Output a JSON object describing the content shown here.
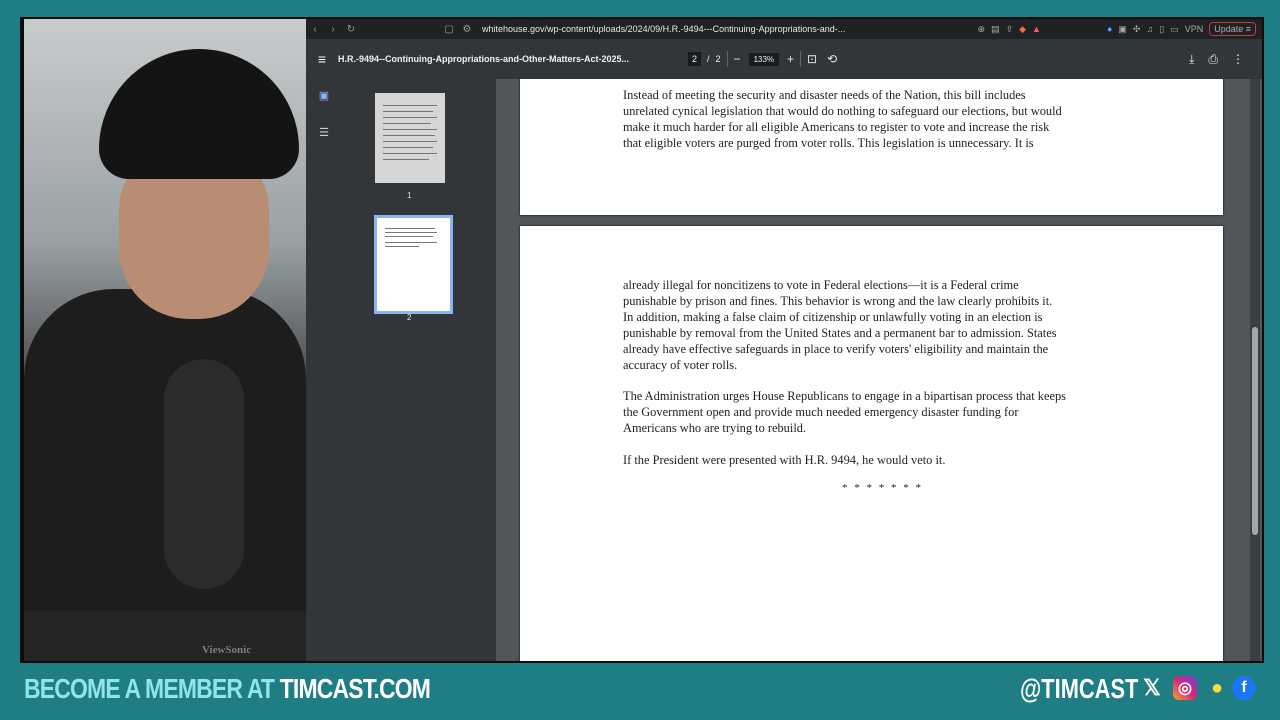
{
  "browser": {
    "url": "whitehouse.gov/wp-content/uploads/2024/09/H.R.-9494---Continuing-Appropriations-and-...",
    "vpn_label": "VPN",
    "update_label": "Update",
    "badge_count": "1"
  },
  "pdf": {
    "title": "H.R.-9494--Continuing-Appropriations-and-Other-Matters-Act-2025...",
    "current_page": "2",
    "page_sep": "/",
    "total_pages": "2",
    "zoom": "133%",
    "thumbnails": [
      {
        "label": "1"
      },
      {
        "label": "2"
      }
    ],
    "page1_text": "Instead of meeting the security and disaster needs of the Nation, this bill includes\nunrelated cynical legislation that would do nothing to safeguard our elections, but would\nmake it much harder for all eligible Americans to register to vote and increase the risk\nthat eligible voters are purged from voter rolls.  This legislation is unnecessary.  It is",
    "page2_para1": "already illegal for noncitizens to vote in Federal elections—it is a Federal crime\npunishable by prison and fines.  This behavior is wrong and the law clearly prohibits it.\nIn addition, making a false claim of citizenship or unlawfully voting in an election is\npunishable by removal from the United States and a permanent bar to admission.  States\nalready have effective safeguards in place to verify voters' eligibility and maintain the\naccuracy of voter rolls.",
    "page2_para2": "The Administration urges House Republicans to engage in a bipartisan process that keeps\nthe Government open and provide much needed emergency disaster funding for\nAmericans who are trying to rebuild.",
    "page2_para3": "If the President were presented with H.R. 9494, he would veto it.",
    "page2_stars": "* * * * * * *"
  },
  "webcam": {
    "monitor_brand": "ViewSonic"
  },
  "overlay": {
    "cta_prefix": "BECOME A MEMBER AT ",
    "cta_site": "TIMCAST.COM",
    "handle": "@TIMCAST",
    "colors": {
      "teal": "#1f7d84",
      "cta": "#8fe6ea"
    },
    "social_icons": [
      "x-icon",
      "instagram-icon",
      "lightbulb-icon",
      "facebook-icon"
    ]
  }
}
